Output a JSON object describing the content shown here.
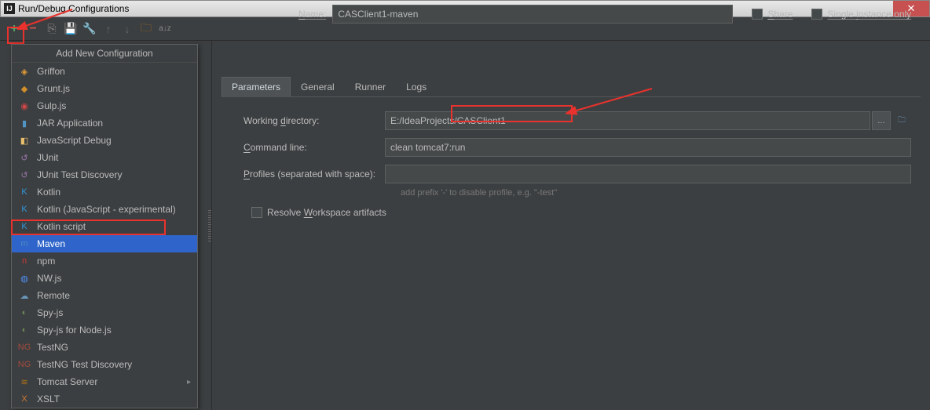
{
  "titlebar": {
    "title": "Run/Debug Configurations"
  },
  "toolbar": {
    "plus": "+",
    "minus": "−"
  },
  "nameRow": {
    "label": "Name:",
    "value": "CASClient1-maven",
    "share": "Share",
    "single": "Single instance only"
  },
  "tabs": [
    "Parameters",
    "General",
    "Runner",
    "Logs"
  ],
  "form": {
    "workingDirLabel": "Working directory:",
    "workingDirVal": "E:/IdeaProjects/CASClient1",
    "cmdLabel": "Command line:",
    "cmdVal": "clean tomcat7:run",
    "profilesLabel": "Profiles (separated with space):",
    "profilesVal": "",
    "profilesHint": "add prefix '-' to disable profile, e.g. \"-test\"",
    "resolve": "Resolve Workspace artifacts"
  },
  "popup": {
    "title": "Add New Configuration",
    "items": [
      {
        "label": "Griffon",
        "cls": "ic-g",
        "glyph": "◈"
      },
      {
        "label": "Grunt.js",
        "cls": "ic-gr",
        "glyph": "◆"
      },
      {
        "label": "Gulp.js",
        "cls": "ic-gulp",
        "glyph": "◉"
      },
      {
        "label": "JAR Application",
        "cls": "ic-jar",
        "glyph": "▮"
      },
      {
        "label": "JavaScript Debug",
        "cls": "ic-js",
        "glyph": "◧"
      },
      {
        "label": "JUnit",
        "cls": "ic-junit",
        "glyph": "↺"
      },
      {
        "label": "JUnit Test Discovery",
        "cls": "ic-junit",
        "glyph": "↺"
      },
      {
        "label": "Kotlin",
        "cls": "ic-kt",
        "glyph": "K"
      },
      {
        "label": "Kotlin (JavaScript - experimental)",
        "cls": "ic-kt",
        "glyph": "K"
      },
      {
        "label": "Kotlin script",
        "cls": "ic-kt",
        "glyph": "K"
      },
      {
        "label": "Maven",
        "cls": "ic-maven",
        "glyph": "m",
        "selected": true
      },
      {
        "label": "npm",
        "cls": "ic-npm",
        "glyph": "n"
      },
      {
        "label": "NW.js",
        "cls": "ic-nw",
        "glyph": "◍"
      },
      {
        "label": "Remote",
        "cls": "ic-remote",
        "glyph": "☁"
      },
      {
        "label": "Spy-js",
        "cls": "ic-spy",
        "glyph": "◐"
      },
      {
        "label": "Spy-js for Node.js",
        "cls": "ic-spy",
        "glyph": "◐"
      },
      {
        "label": "TestNG",
        "cls": "ic-tng",
        "glyph": "NG"
      },
      {
        "label": "TestNG Test Discovery",
        "cls": "ic-tng",
        "glyph": "NG"
      },
      {
        "label": "Tomcat Server",
        "cls": "ic-tomcat",
        "glyph": "≋",
        "hasSub": true
      },
      {
        "label": "XSLT",
        "cls": "ic-xslt",
        "glyph": "X"
      }
    ]
  }
}
